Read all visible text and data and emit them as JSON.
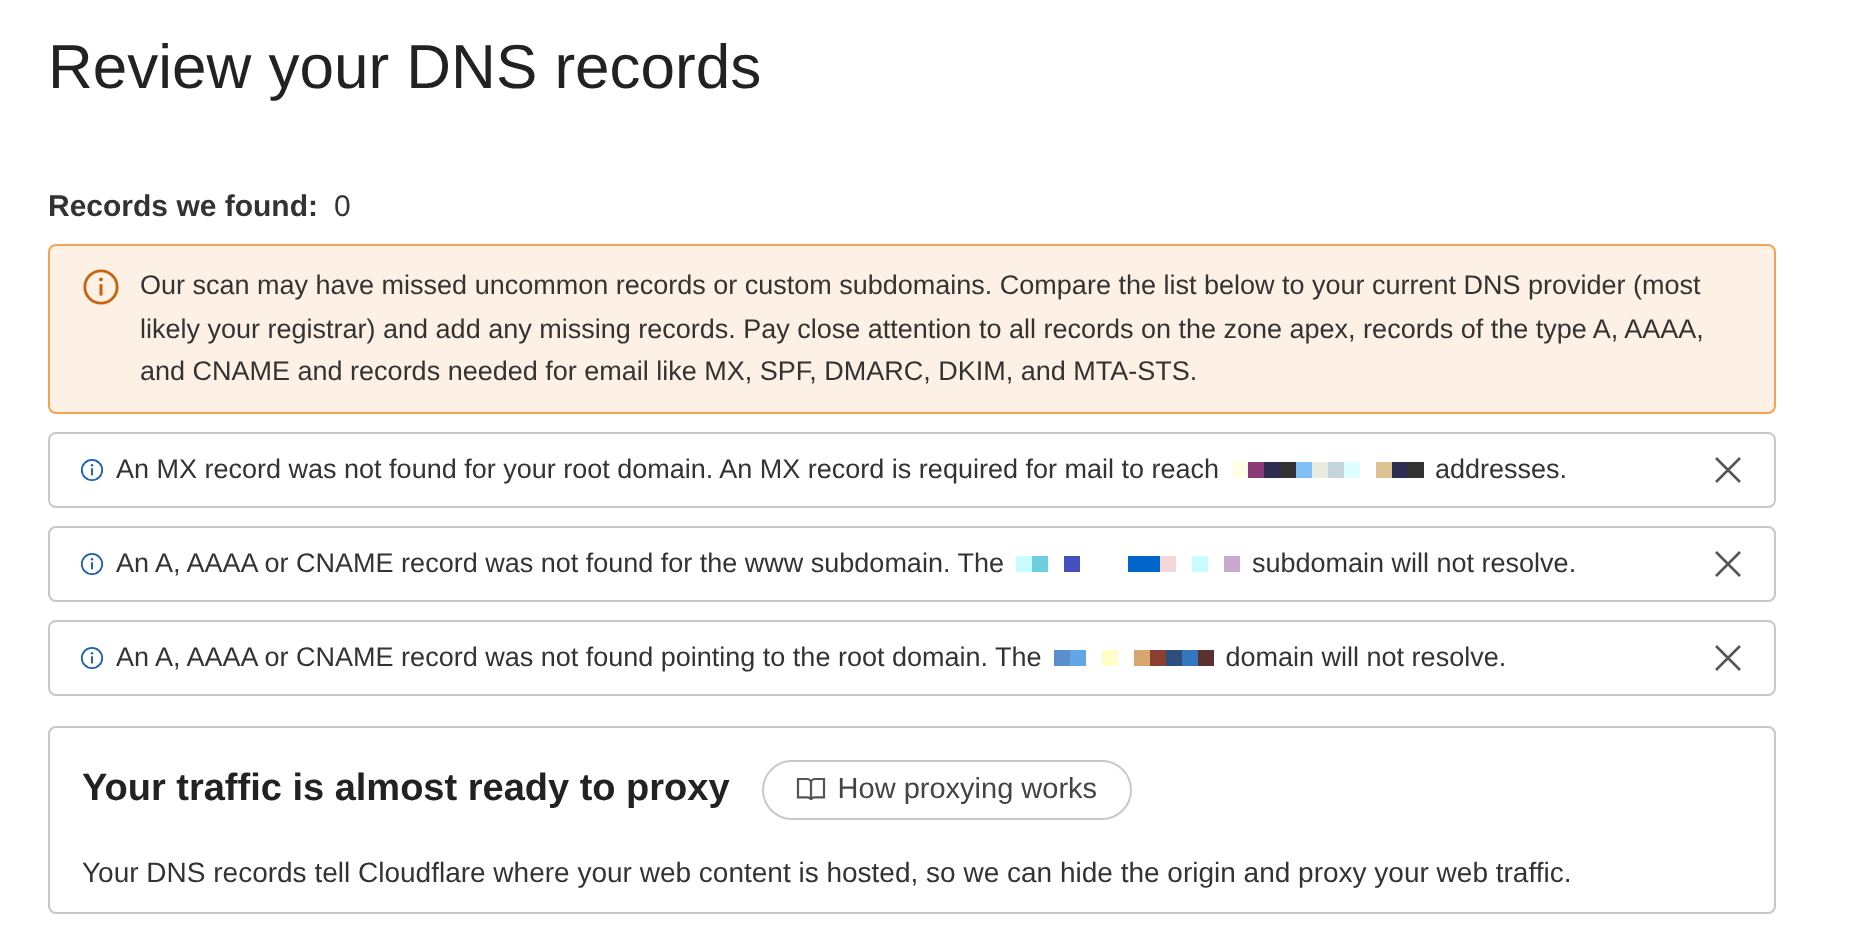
{
  "title": "Review your DNS records",
  "records_found": {
    "label": "Records we found:",
    "count": "0"
  },
  "warning": {
    "text": "Our scan may have missed uncommon records or custom subdomains. Compare the list below to your current DNS provider (most likely your registrar) and add any missing records. Pay close attention to all records on the zone apex, records of the type A, AAAA, and CNAME and records needed for email like MX, SPF, DMARC, DKIM, and MTA-STS."
  },
  "notices": [
    {
      "before": "An MX record was not found for your root domain. An MX record is required for mail to reach",
      "after": "addresses."
    },
    {
      "before": "An A, AAAA or CNAME record was not found for the www subdomain. The",
      "after": "subdomain will not resolve."
    },
    {
      "before": "An A, AAAA or CNAME record was not found pointing to the root domain. The",
      "after": "domain will not resolve."
    }
  ],
  "proxy_card": {
    "title": "Your traffic is almost ready to proxy",
    "button": "How proxying works",
    "text": "Your DNS records tell Cloudflare where your web content is hosted, so we can hide the origin and proxy your web traffic."
  }
}
